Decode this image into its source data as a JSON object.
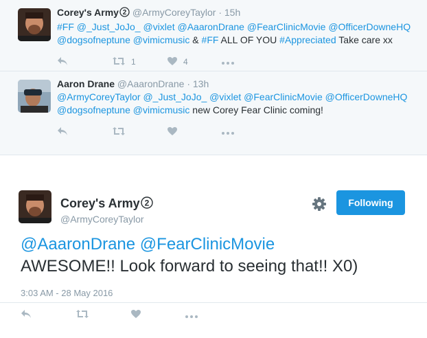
{
  "tweets": [
    {
      "name": "Corey's Army",
      "handle": "@ArmyCoreyTaylor",
      "dot": "·",
      "time": "15h",
      "text_parts": [
        {
          "t": "#FF @_Just_JoJo_ @vixlet @AaaronDrane @FearClinicMovie @OfficerDowneHQ @dogsofneptune @vimicmusic",
          "link": true
        },
        {
          "t": " & ",
          "link": false
        },
        {
          "t": "#FF",
          "link": true
        },
        {
          "t": " ALL OF YOU ",
          "link": false
        },
        {
          "t": "#Appreciated",
          "link": true
        },
        {
          "t": " Take care xx",
          "link": false
        }
      ],
      "retweets": "1",
      "likes": "4"
    },
    {
      "name": "Aaron Drane",
      "handle": "@AaaronDrane",
      "dot": "·",
      "time": "13h",
      "text_parts": [
        {
          "t": "@ArmyCoreyTaylor @_Just_JoJo_ @vixlet @FearClinicMovie @OfficerDowneHQ @dogsofneptune @vimicmusic",
          "link": true
        },
        {
          "t": " new Corey Fear Clinic coming!",
          "link": false
        }
      ],
      "retweets": "",
      "likes": ""
    }
  ],
  "main": {
    "name": "Corey's Army",
    "handle": "@ArmyCoreyTaylor",
    "follow_label": "Following",
    "text_link": "@AaaronDrane @FearClinicMovie",
    "text_body": "AWESOME!! Look forward to seeing that!! X0)",
    "date": "3:03 AM - 28 May 2016"
  },
  "icons": {
    "reply": "reply-icon",
    "retweet": "retweet-icon",
    "like": "heart-icon",
    "more": "more-icon",
    "settings": "gear-icon",
    "verified": "circled-2-icon"
  },
  "colors": {
    "link": "#1b95e0",
    "button": "#1b95e0",
    "muted": "#8899a6",
    "icon": "#aab8c2",
    "thread_bg": "#f5f8fa"
  }
}
